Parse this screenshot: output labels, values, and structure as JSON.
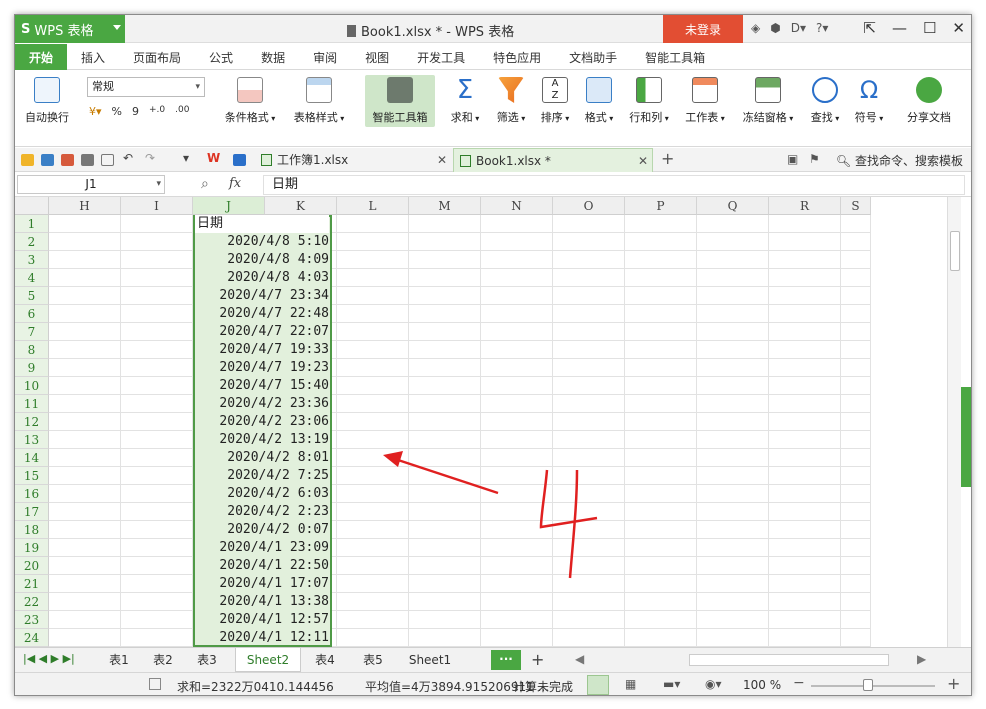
{
  "app": {
    "name": "WPS 表格",
    "logo": "S",
    "window_title": "Book1.xlsx * - WPS 表格",
    "login": "未登录"
  },
  "ribbon_tabs": [
    "开始",
    "插入",
    "页面布局",
    "公式",
    "数据",
    "审阅",
    "视图",
    "开发工具",
    "特色应用",
    "文档助手",
    "智能工具箱"
  ],
  "ribbon": {
    "wrap": "自动换行",
    "number_format": "常规",
    "cond_format": "条件格式",
    "table_style": "表格样式",
    "smart_toolbox": "智能工具箱",
    "sum": "求和",
    "filter": "筛选",
    "sort": "排序",
    "format": "格式",
    "rowcol": "行和列",
    "worksheet": "工作表",
    "freeze": "冻结窗格",
    "find": "查找",
    "symbol": "符号",
    "share": "分享文档",
    "percent": "%",
    "comma": "9"
  },
  "doc_tabs": [
    {
      "label": "工作簿1.xlsx"
    },
    {
      "label": "Book1.xlsx *"
    }
  ],
  "quick_search": "查找命令、搜索模板",
  "formula_bar": {
    "name_box": "J1",
    "fx": "fx",
    "content": "日期"
  },
  "columns": [
    "H",
    "I",
    "J",
    "K",
    "L",
    "M",
    "N",
    "O",
    "P",
    "Q",
    "R",
    "S"
  ],
  "rows": [
    "1",
    "2",
    "3",
    "4",
    "5",
    "6",
    "7",
    "8",
    "9",
    "10",
    "11",
    "12",
    "13",
    "14",
    "15",
    "16",
    "17",
    "18",
    "19",
    "20",
    "21",
    "22",
    "23",
    "24"
  ],
  "header_cell": "日期",
  "dates": [
    "2020/4/8 5:10",
    "2020/4/8 4:09",
    "2020/4/8 4:03",
    "2020/4/7 23:34",
    "2020/4/7 22:48",
    "2020/4/7 22:07",
    "2020/4/7 19:33",
    "2020/4/7 19:23",
    "2020/4/7 15:40",
    "2020/4/2 23:36",
    "2020/4/2 23:06",
    "2020/4/2 13:19",
    "2020/4/2 8:01",
    "2020/4/2 7:25",
    "2020/4/2 6:03",
    "2020/4/2 2:23",
    "2020/4/2 0:07",
    "2020/4/1 23:09",
    "2020/4/1 22:50",
    "2020/4/1 17:07",
    "2020/4/1 13:38",
    "2020/4/1 12:57",
    "2020/4/1 12:11"
  ],
  "sheets": [
    "表1",
    "表2",
    "表3",
    "Sheet2",
    "表4",
    "表5",
    "Sheet1"
  ],
  "active_sheet": "Sheet2",
  "status": {
    "sum": "求和=2322万0410.144456",
    "avg": "平均值=4万3894.915206911 ...",
    "calc": "计算未完成",
    "zoom": "100 %"
  },
  "annotation": {
    "handwritten": "4",
    "color": "#e02020"
  },
  "colors": {
    "accent": "#4aa742",
    "login": "#e24e33",
    "selection": "#e2f0dc"
  }
}
